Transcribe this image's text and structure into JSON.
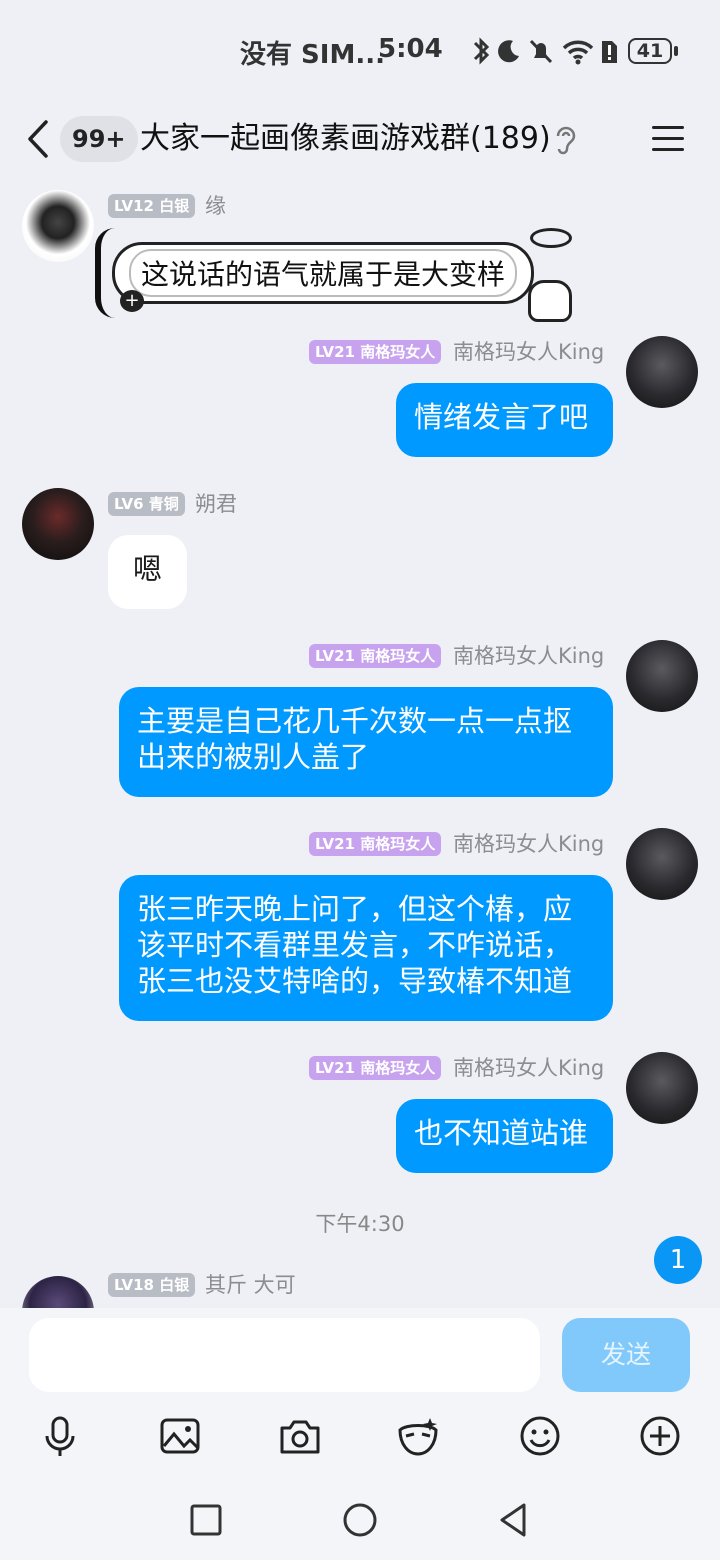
{
  "status_bar": {
    "carrier": "没有 SIM...",
    "time": "5:04",
    "battery": "41"
  },
  "header": {
    "unread_count": "99+",
    "title": "大家一起画像素画游戏群(189)"
  },
  "messages": [
    {
      "level": "LV12 白银",
      "name": "缘",
      "text": "这说话的语气就属于是大变样",
      "side": "left"
    },
    {
      "level": "LV21 南格玛女人",
      "name": "南格玛女人King",
      "text": "情绪发言了吧",
      "side": "right"
    },
    {
      "level": "LV6 青铜",
      "name": "朔君",
      "text": "嗯",
      "side": "left"
    },
    {
      "level": "LV21 南格玛女人",
      "name": "南格玛女人King",
      "text": "主要是自己花几千次数一点一点抠出来的被别人盖了",
      "side": "right"
    },
    {
      "level": "LV21 南格玛女人",
      "name": "南格玛女人King",
      "text": "张三昨天晚上问了，但这个椿，应该平时不看群里发言，不咋说话，张三也没艾特啥的，导致椿不知道",
      "side": "right"
    },
    {
      "level": "LV21 南格玛女人",
      "name": "南格玛女人King",
      "text": "也不知道站谁",
      "side": "right"
    }
  ],
  "timestamp": "下午4:30",
  "last_sender": {
    "level": "LV18 白银",
    "name": "其斤 大可"
  },
  "new_message_badge": "1",
  "composer": {
    "placeholder": "",
    "send_label": "发送"
  },
  "colors": {
    "bubble_blue": "#0099ff",
    "background": "#eef0f5",
    "send_disabled": "#80c9fa"
  }
}
